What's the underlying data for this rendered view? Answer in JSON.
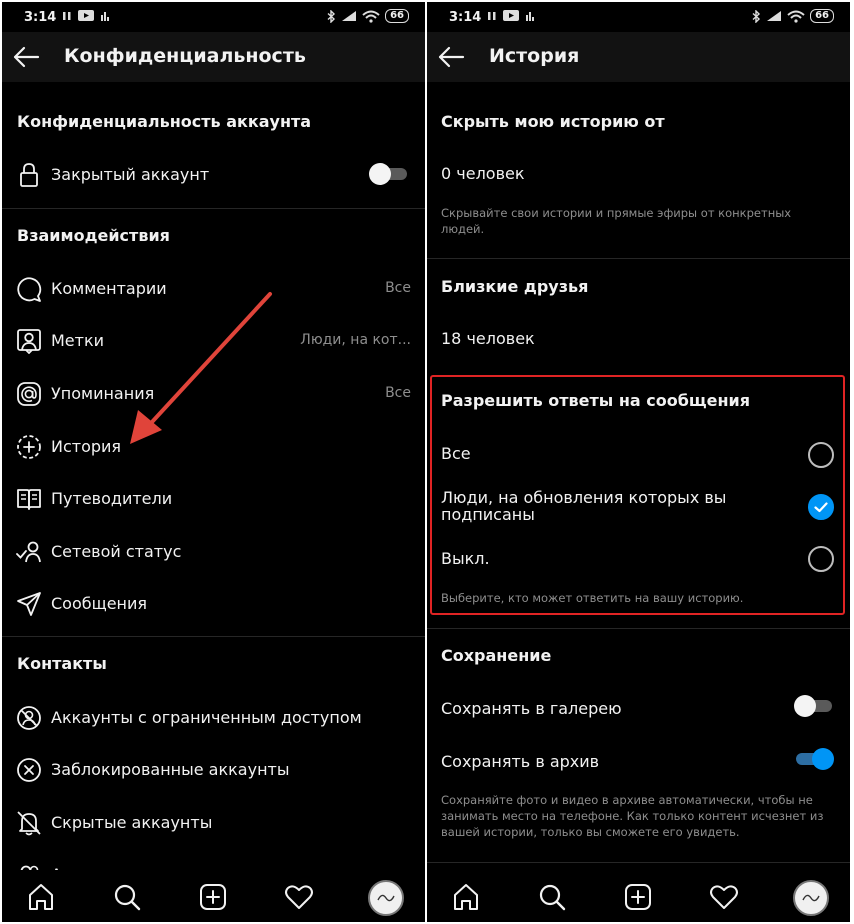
{
  "status": {
    "time": "3:14",
    "battery": "66"
  },
  "left": {
    "title": "Конфиденциальность",
    "section_account": "Конфиденциальность аккаунта",
    "private_account": "Закрытый аккаунт",
    "section_interactions": "Взаимодействия",
    "interactions": [
      {
        "label": "Комментарии",
        "value": "Все",
        "icon": "comment-icon"
      },
      {
        "label": "Метки",
        "value": "Люди, на кот...",
        "icon": "tag-person-icon"
      },
      {
        "label": "Упоминания",
        "value": "Все",
        "icon": "at-icon"
      },
      {
        "label": "История",
        "value": "",
        "icon": "story-add-icon"
      },
      {
        "label": "Путеводители",
        "value": "",
        "icon": "guide-book-icon"
      },
      {
        "label": "Сетевой статус",
        "value": "",
        "icon": "activity-status-icon"
      },
      {
        "label": "Сообщения",
        "value": "",
        "icon": "send-icon"
      }
    ],
    "section_contacts": "Контакты",
    "contacts": [
      {
        "label": "Аккаунты с ограниченным доступом",
        "icon": "restricted-icon"
      },
      {
        "label": "Заблокированные аккаунты",
        "icon": "blocked-icon"
      },
      {
        "label": "Скрытые аккаунты",
        "icon": "muted-bell-icon"
      },
      {
        "label": "Аккаунты, на которые вы подписаны",
        "icon": "following-icon"
      }
    ]
  },
  "right": {
    "title": "История",
    "hide_story_title": "Скрыть мою историю от",
    "hide_story_count": "0 человек",
    "hide_story_hint": "Скрывайте свои истории и прямые эфиры от конкретных людей.",
    "close_friends_title": "Близкие друзья",
    "close_friends_count": "18 человек",
    "replies_title": "Разрешить ответы на сообщения",
    "replies_options": [
      {
        "label": "Все",
        "selected": false
      },
      {
        "label": "Люди, на обновления которых вы подписаны",
        "selected": true
      },
      {
        "label": "Выкл.",
        "selected": false
      }
    ],
    "replies_hint": "Выберите, кто может ответить на вашу историю.",
    "saving_title": "Сохранение",
    "save_gallery": "Сохранять в галерею",
    "save_gallery_on": false,
    "save_archive": "Сохранять в архив",
    "save_archive_on": true,
    "archive_hint": "Сохраняйте фото и видео в архиве автоматически, чтобы не занимать место на телефоне. Как только контент исчезнет из вашей истории, только вы сможете его увидеть."
  },
  "nav": [
    "home-icon",
    "search-icon",
    "new-post-icon",
    "activity-heart-icon",
    "profile-avatar"
  ],
  "colors": {
    "accent": "#0095f6",
    "highlight": "#e02424",
    "arrow": "#e0443a"
  }
}
